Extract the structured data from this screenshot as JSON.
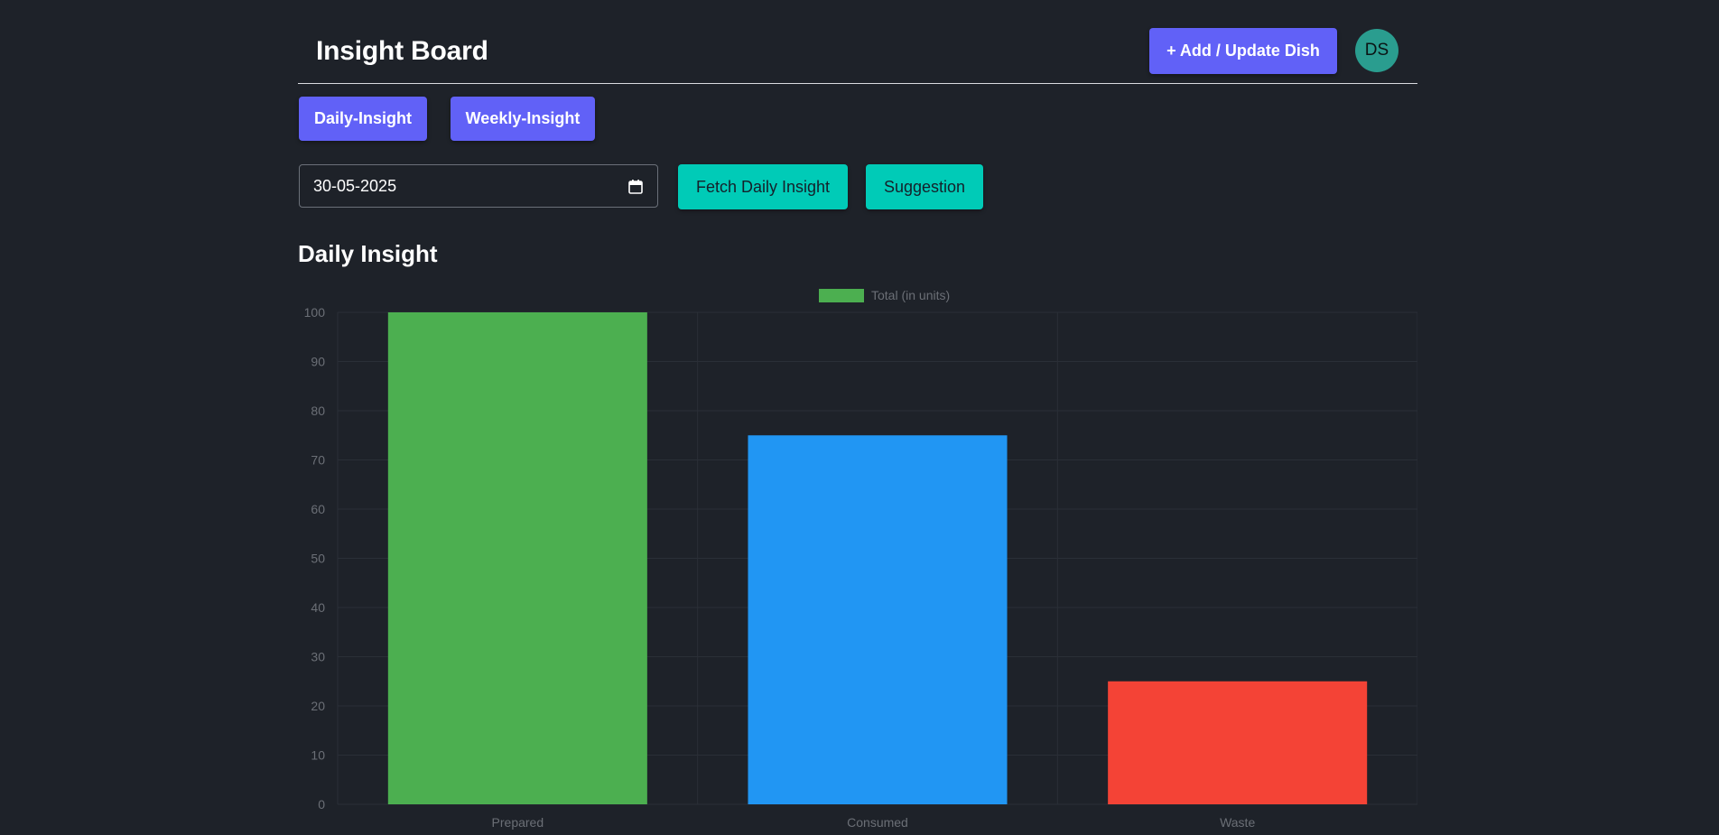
{
  "header": {
    "title": "Insight Board",
    "add_button_label": "+ Add / Update Dish",
    "avatar_initials": "DS"
  },
  "tabs": [
    {
      "label": "Daily-Insight"
    },
    {
      "label": "Weekly-Insight"
    }
  ],
  "controls": {
    "date_value": "30-05-2025",
    "fetch_button_label": "Fetch Daily Insight",
    "suggestion_button_label": "Suggestion"
  },
  "section": {
    "title": "Daily Insight"
  },
  "colors": {
    "background": "#1e2229",
    "primary_button": "#6161f7",
    "accent_button": "#00cbb7",
    "avatar": "#2a9d8f"
  },
  "chart_data": {
    "type": "bar",
    "categories": [
      "Prepared",
      "Consumed",
      "Waste"
    ],
    "series": [
      {
        "name": "Total (in units)",
        "values": [
          100,
          75,
          25
        ]
      }
    ],
    "bar_colors": [
      "#4caf50",
      "#2196f3",
      "#f44336"
    ],
    "legend_color": "#4caf50",
    "ylim": [
      0,
      100
    ],
    "yticks": [
      0,
      10,
      20,
      30,
      40,
      50,
      60,
      70,
      80,
      90,
      100
    ],
    "legend_position": "top",
    "grid": true
  }
}
